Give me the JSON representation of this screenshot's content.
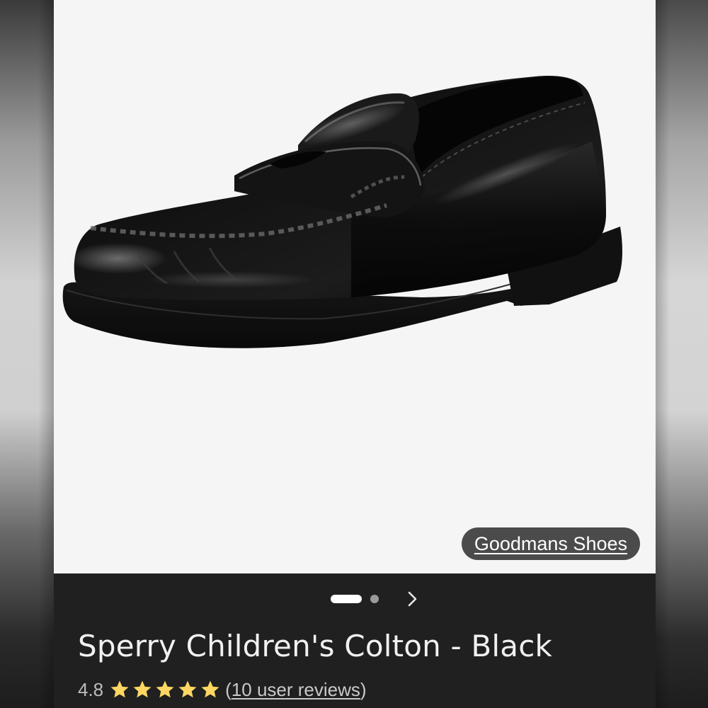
{
  "product": {
    "title": "Sperry Children's Colton - Black",
    "rating": "4.8",
    "star_count": 5,
    "star_color": "#fdd663",
    "reviews_open": "(",
    "reviews_text": "10 user reviews",
    "reviews_close": ")"
  },
  "image": {
    "subject": "black penny loafer shoe",
    "background_color": "#f5f5f5"
  },
  "source_chip": {
    "label": "Goodmans Shoes"
  },
  "carousel": {
    "total_images": 2,
    "current_image": 1,
    "next_icon": "chevron-right-icon"
  },
  "theme": {
    "panel_background": "#202020",
    "text_primary": "#f1f1f1",
    "chip_background": "#4b4b4b"
  }
}
